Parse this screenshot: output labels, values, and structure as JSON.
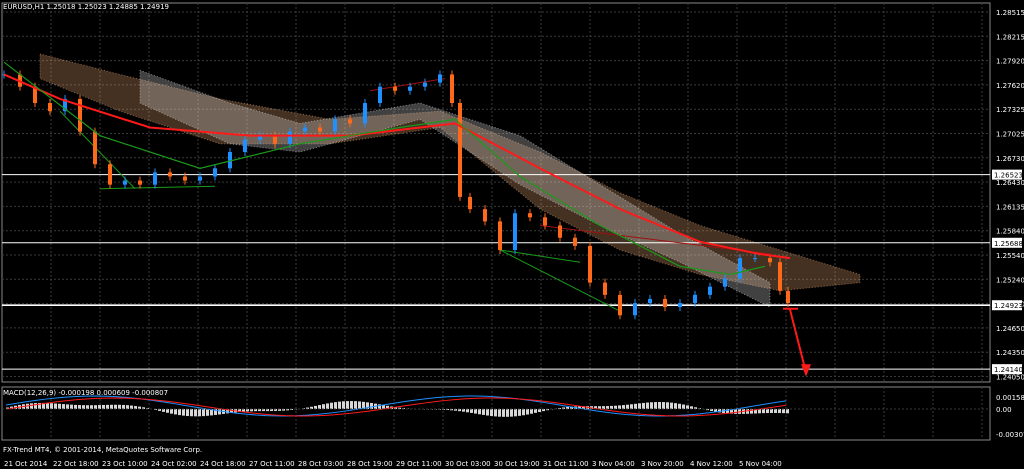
{
  "chart_header": "EURUSD,H1  1.25018 1.25023 1.24885 1.24919",
  "macd_header": "MACD(12,26,9) -0.000198 0.000609 -0.000807",
  "footer_text": "FX-Trend MT4, © 2001-2014, MetaQuotes Software Corp.",
  "colors": {
    "background": "#000000",
    "grid": "#3a3a3a",
    "bull_candle": "#1e90ff",
    "bear_candle": "#ff6a1a",
    "ma_red": "#ff1a1a",
    "ma_green": "#1a9a1a",
    "cloud_peach": "#f4b07a",
    "cloud_white": "#e8e8e8",
    "level_line": "#ffffff"
  },
  "price_axis": {
    "labels": [
      "1.28515",
      "1.28215",
      "1.27920",
      "1.27620",
      "1.27325",
      "1.27025",
      "1.26730",
      "1.26430",
      "1.26135",
      "1.25840",
      "1.25540",
      "1.25240",
      "1.24950",
      "1.24650",
      "1.24350",
      "1.24050"
    ],
    "level_labels": [
      "1.26523",
      "1.25688",
      "1.24923",
      "1.24140"
    ]
  },
  "macd_axis": {
    "labels": [
      "0.001588",
      "0.00",
      "-0.003073"
    ]
  },
  "time_axis": {
    "labels": [
      "21 Oct 2014",
      "22 Oct 18:00",
      "23 Oct 10:00",
      "24 Oct 02:00",
      "24 Oct 18:00",
      "27 Oct 11:00",
      "28 Oct 03:00",
      "28 Oct 19:00",
      "29 Oct 11:00",
      "30 Oct 03:00",
      "30 Oct 19:00",
      "31 Oct 11:00",
      "3 Nov 04:00",
      "3 Nov 20:00",
      "4 Nov 12:00",
      "5 Nov 04:00"
    ]
  }
}
